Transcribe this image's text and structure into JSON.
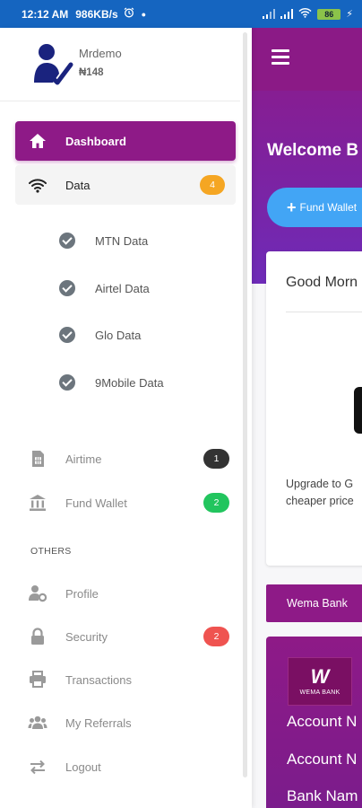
{
  "status_bar": {
    "time": "12:12 AM",
    "speed": "986KB/s",
    "battery": "86",
    "icons": [
      "alarm-icon",
      "signal-icon",
      "signal-icon",
      "wifi-icon",
      "battery-icon",
      "charging-icon"
    ]
  },
  "drawer": {
    "user": {
      "name": "Mrdemo",
      "balance": "₦148"
    },
    "menu": {
      "dashboard": {
        "label": "Dashboard",
        "icon": "home-icon"
      },
      "data": {
        "label": "Data",
        "icon": "wifi-icon",
        "badge": "4",
        "badge_color": "#f5a623"
      },
      "data_items": [
        {
          "label": "MTN Data"
        },
        {
          "label": "Airtel Data"
        },
        {
          "label": "Glo Data"
        },
        {
          "label": "9Mobile Data"
        }
      ],
      "airtime": {
        "label": "Airtime",
        "icon": "sim-card-icon",
        "badge": "1",
        "badge_color": "#333333"
      },
      "fund_wallet": {
        "label": "Fund Wallet",
        "icon": "bank-icon",
        "badge": "2",
        "badge_color": "#22c55e"
      }
    },
    "others": {
      "heading": "OTHERS",
      "profile": {
        "label": "Profile",
        "icon": "user-cog-icon"
      },
      "security": {
        "label": "Security",
        "icon": "lock-icon",
        "badge": "2",
        "badge_color": "#ef5350"
      },
      "transactions": {
        "label": "Transactions",
        "icon": "printer-icon"
      },
      "referrals": {
        "label": "My Referrals",
        "icon": "users-icon"
      },
      "logout": {
        "label": "Logout",
        "icon": "exchange-icon"
      }
    }
  },
  "main": {
    "welcome": "Welcome B",
    "fund_button": "Fund Wallet",
    "greeting": "Good Morn",
    "upgrade_line1": "Upgrade to G",
    "upgrade_line2": "cheaper price",
    "bank_tab": "Wema Bank",
    "bank_logo_text": "WEMA BANK",
    "account_name_label": "Account N",
    "account_number_label": "Account N",
    "bank_name_label": "Bank Nam"
  },
  "colors": {
    "primary": "#8e1a87",
    "status_bar": "#1565c0",
    "fund_button": "#42a5f5"
  }
}
